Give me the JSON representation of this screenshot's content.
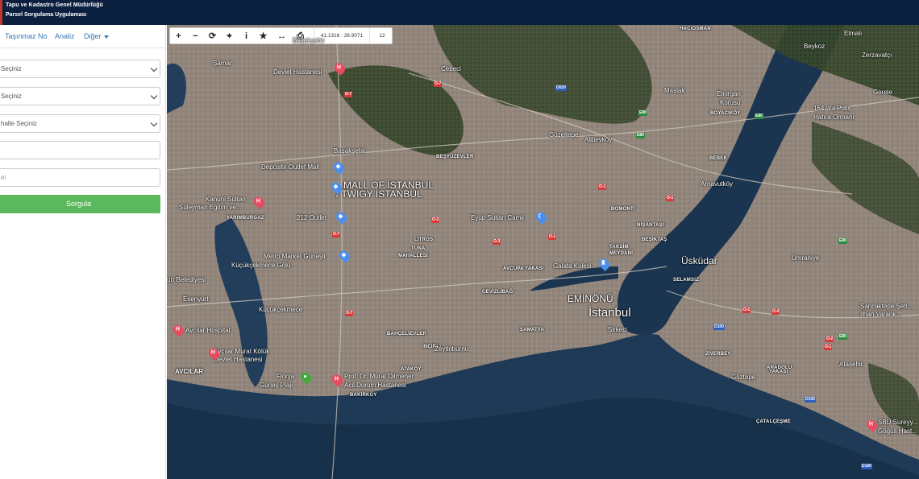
{
  "header": {
    "line1": "Tapu ve Kadastro Genel Müdürlüğü",
    "line2": "Parsel Sorgulama Uygulaması"
  },
  "sidebar": {
    "tabs": [
      "Taşınmaz No",
      "Analiz",
      "Diğer"
    ],
    "fields": [
      {
        "value": "Seçiniz",
        "type": "select"
      },
      {
        "value": "Seçiniz",
        "type": "select"
      },
      {
        "value": "halle Seçiniz",
        "type": "select"
      },
      {
        "value": "",
        "type": "input"
      },
      {
        "value": "el",
        "type": "input"
      }
    ],
    "button": "Sorgula"
  },
  "toolbar": {
    "icons": [
      "plus-icon",
      "minus-icon",
      "refresh-icon",
      "crosshair-icon",
      "info-icon",
      "star-icon",
      "measure-icon",
      "print-icon"
    ],
    "glyphs": [
      "+",
      "−",
      "⟳",
      "⌖",
      "i",
      "★",
      "↔",
      "⎙"
    ],
    "coordinates": "41.1316 : 28.9071",
    "zoom": "12"
  },
  "map": {
    "labels": [
      {
        "text": "HACIOSMAN",
        "cls": "sm"
      },
      {
        "text": "Elmalı",
        "cls": ""
      },
      {
        "text": "Beykoz",
        "cls": ""
      },
      {
        "text": "Zerzavatçı",
        "cls": ""
      },
      {
        "text": "Şamar",
        "cls": ""
      },
      {
        "text": "Başakşehir",
        "cls": ""
      },
      {
        "text": "Devlet Hastanesi",
        "cls": ""
      },
      {
        "text": "Cebeci",
        "cls": ""
      },
      {
        "text": "Maslak",
        "cls": ""
      },
      {
        "text": "Emirgan",
        "cls": ""
      },
      {
        "text": "Korusu",
        "cls": ""
      },
      {
        "text": "BOYACIKÖY",
        "cls": "sm"
      },
      {
        "text": "164. Yıl Polis",
        "cls": ""
      },
      {
        "text": "Hatıra Ormanı",
        "cls": ""
      },
      {
        "text": "Gorele",
        "cls": ""
      },
      {
        "text": "Güzeltepe",
        "cls": ""
      },
      {
        "text": "Alibeyköy",
        "cls": ""
      },
      {
        "text": "Başakşehir",
        "cls": ""
      },
      {
        "text": "BEŞYÜZEVLER",
        "cls": "sm"
      },
      {
        "text": "BEBEK",
        "cls": "sm"
      },
      {
        "text": "Deposite Outlet Mall",
        "cls": ""
      },
      {
        "text": "MALL OF İSTANBUL",
        "cls": "md"
      },
      {
        "text": "/ TWIGY İSTANBUL",
        "cls": "md"
      },
      {
        "text": "Arnavutköy",
        "cls": ""
      },
      {
        "text": "Kanuni Sultan",
        "cls": ""
      },
      {
        "text": "Süleyman Eğitim ve...",
        "cls": ""
      },
      {
        "text": "YARIMBURGAZ",
        "cls": "sm"
      },
      {
        "text": "212 Outlet",
        "cls": ""
      },
      {
        "text": "BOMONTİ",
        "cls": "sm"
      },
      {
        "text": "Eyüp Sultan Camii",
        "cls": ""
      },
      {
        "text": "NİŞANTAŞI",
        "cls": "sm"
      },
      {
        "text": "BEŞİKTAŞ",
        "cls": "sm"
      },
      {
        "text": "LİTROS",
        "cls": "sm"
      },
      {
        "text": "TUNA",
        "cls": "sm"
      },
      {
        "text": "MAHALLESİ",
        "cls": "sm"
      },
      {
        "text": "TAKSİM",
        "cls": "sm"
      },
      {
        "text": "MEYDANI",
        "cls": "sm"
      },
      {
        "text": "Metro Market Güneşli",
        "cls": ""
      },
      {
        "text": "Galata Kulesi",
        "cls": ""
      },
      {
        "text": "Üsküdar",
        "cls": "md"
      },
      {
        "text": "Ümraniye",
        "cls": ""
      },
      {
        "text": "AVCUPA YAKASI",
        "cls": "sm"
      },
      {
        "text": "Küçükçekmece Gölü",
        "cls": ""
      },
      {
        "text": "urt Belediyesi",
        "cls": ""
      },
      {
        "text": "SELAMSIZ",
        "cls": "sm"
      },
      {
        "text": "CEVİZLİBAĞ",
        "cls": "sm"
      },
      {
        "text": "EMİNÖNÜ",
        "cls": "md"
      },
      {
        "text": "İstanbul",
        "cls": "lg"
      },
      {
        "text": "Esenyurt",
        "cls": ""
      },
      {
        "text": "Küçükçekmece",
        "cls": ""
      },
      {
        "text": "Sancaktepe Şeh...",
        "cls": ""
      },
      {
        "text": "İlhan Varank...",
        "cls": ""
      },
      {
        "text": "Avcılar Hospital",
        "cls": ""
      },
      {
        "text": "BAHÇELİEVLER",
        "cls": "sm"
      },
      {
        "text": "SAMATYA",
        "cls": "sm"
      },
      {
        "text": "Şirkeci",
        "cls": ""
      },
      {
        "text": "Avcılar Murat Kölük",
        "cls": ""
      },
      {
        "text": "Devlet Hastanesi",
        "cls": ""
      },
      {
        "text": "İNCİRLİ",
        "cls": "sm"
      },
      {
        "text": "Zeytinburnu",
        "cls": ""
      },
      {
        "text": "ZİVERBEY",
        "cls": "sm"
      },
      {
        "text": "Ataşehir",
        "cls": ""
      },
      {
        "text": "AVCILAR",
        "cls": "bold"
      },
      {
        "text": "ATAKÖY",
        "cls": "sm"
      },
      {
        "text": "ANADOLU",
        "cls": "sm"
      },
      {
        "text": "YAKASI",
        "cls": "sm"
      },
      {
        "text": "Florya",
        "cls": ""
      },
      {
        "text": "Güneş Plajı",
        "cls": ""
      },
      {
        "text": "Prof. Dr. Murat Dilmener",
        "cls": ""
      },
      {
        "text": "Acil Durum Hastanesi",
        "cls": ""
      },
      {
        "text": "Göztepe",
        "cls": ""
      },
      {
        "text": "BAKIRKÖY",
        "cls": "sm"
      },
      {
        "text": "ÇATALÇEŞME",
        "cls": "sm"
      },
      {
        "text": "SBÜ Sureyy...",
        "cls": ""
      },
      {
        "text": "Göğüs Hast...",
        "cls": ""
      }
    ],
    "pins": [
      {
        "kind": "h",
        "glyph": "H",
        "name": "hospital-pin-icon"
      },
      {
        "kind": "b",
        "glyph": "◆",
        "name": "shopping-pin-icon"
      },
      {
        "kind": "b",
        "glyph": "◆",
        "name": "shopping-pin-icon"
      },
      {
        "kind": "h",
        "glyph": "H",
        "name": "hospital-pin-icon"
      },
      {
        "kind": "b",
        "glyph": "◆",
        "name": "shopping-pin-icon"
      },
      {
        "kind": "b",
        "glyph": "◆",
        "name": "shopping-pin-icon"
      },
      {
        "kind": "t",
        "glyph": "☾",
        "name": "mosque-pin-icon"
      },
      {
        "kind": "t",
        "glyph": "♜",
        "name": "tower-pin-icon"
      },
      {
        "kind": "h",
        "glyph": "H",
        "name": "hospital-pin-icon"
      },
      {
        "kind": "h",
        "glyph": "H",
        "name": "hospital-pin-icon"
      },
      {
        "kind": "g",
        "glyph": "●",
        "name": "park-pin-icon"
      },
      {
        "kind": "h",
        "glyph": "H",
        "name": "hospital-pin-icon"
      },
      {
        "kind": "h",
        "glyph": "H",
        "name": "hospital-pin-icon"
      }
    ],
    "road_shields": [
      {
        "text": "O-7",
        "color": "red"
      },
      {
        "text": "O-7",
        "color": "red"
      },
      {
        "text": "D020",
        "color": "blue"
      },
      {
        "text": "E80",
        "color": "green"
      },
      {
        "text": "O-1",
        "color": "red"
      },
      {
        "text": "O-1",
        "color": "red"
      },
      {
        "text": "O-3",
        "color": "red"
      },
      {
        "text": "O-7",
        "color": "red"
      },
      {
        "text": "O-3",
        "color": "red"
      },
      {
        "text": "O-1",
        "color": "red"
      },
      {
        "text": "O-7",
        "color": "red"
      },
      {
        "text": "O-1",
        "color": "red"
      },
      {
        "text": "O-4",
        "color": "red"
      },
      {
        "text": "D100",
        "color": "blue"
      },
      {
        "text": "E80",
        "color": "green"
      },
      {
        "text": "O-2",
        "color": "red"
      },
      {
        "text": "O-1",
        "color": "red"
      },
      {
        "text": "D100",
        "color": "blue"
      },
      {
        "text": "D100",
        "color": "blue"
      },
      {
        "text": "E80",
        "color": "green"
      },
      {
        "text": "E80",
        "color": "green"
      },
      {
        "text": "E80",
        "color": "green"
      }
    ]
  }
}
